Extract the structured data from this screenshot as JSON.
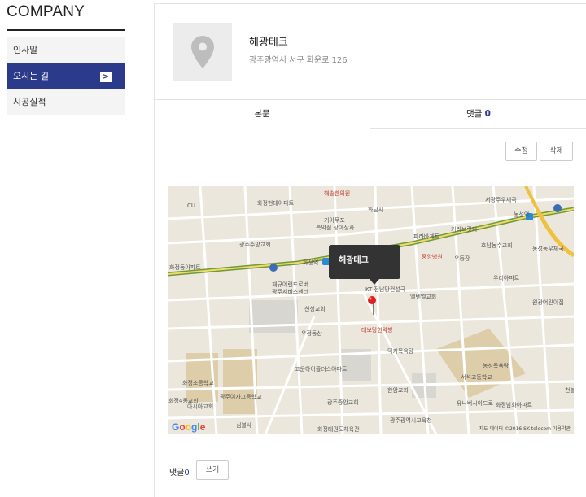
{
  "company": {
    "title": "COMPANY"
  },
  "sidebar": {
    "items": [
      {
        "label": "인사말",
        "active": false
      },
      {
        "label": "오시는 길",
        "active": true
      },
      {
        "label": "시공실적",
        "active": false
      }
    ],
    "active_chevron": ">"
  },
  "place": {
    "name": "해광테크",
    "address": "광주광역시 서구 화운로  126"
  },
  "tabs": [
    {
      "label": "본문"
    },
    {
      "label": "댓글",
      "count": "0"
    }
  ],
  "actions": {
    "edit_label": "수정",
    "delete_label": "삭제"
  },
  "map": {
    "tooltip": "해광테크",
    "labels": [
      "해솔한의원",
      "화정현대아파트",
      "화담사",
      "서광주우체국",
      "농성역",
      "기아무포",
      "특약점 상아상사",
      "파라바게트",
      "커리브릿지",
      "광주주양교회",
      "중앙병원",
      "우등장",
      "호남농수교회",
      "화정역",
      "화정동아파트",
      "재규어랜드로버",
      "광주서비스센터",
      "KT 전남망건설국",
      "엘벤엘교회",
      "우리아파트",
      "천성교회",
      "원광어린이집",
      "대보당한약방",
      "우정동산",
      "덕키목욕탕",
      "고운하이플러스아파트",
      "서석고등학교",
      "농성목욕탕",
      "화정초등학교",
      "광주여자고등학교",
      "아시아교회",
      "광주중앙교회",
      "한암교회",
      "유니버시아드로",
      "광주광역시교육청",
      "화정태권도체육관",
      "심불사",
      "화정남화아파트",
      "농성동우체국",
      "화정4동교회",
      "천불교회",
      "CU"
    ],
    "brand": "Google",
    "attribution": "지도 데이터 ©2016 SK telecom   이용약관"
  },
  "comments": {
    "label": "댓글",
    "count": "0",
    "write_label": "쓰기"
  },
  "colors": {
    "accent": "#2b3a8b"
  }
}
